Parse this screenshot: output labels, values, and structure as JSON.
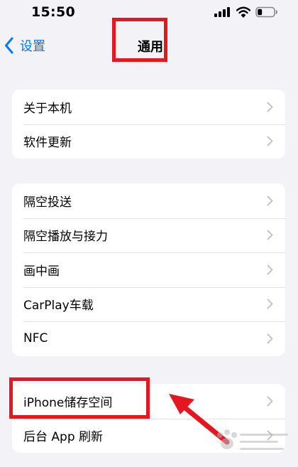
{
  "status_bar": {
    "time": "15:50"
  },
  "nav": {
    "back_label": "设置",
    "title": "通用"
  },
  "groups": [
    {
      "items": [
        {
          "label": "关于本机"
        },
        {
          "label": "软件更新"
        }
      ]
    },
    {
      "items": [
        {
          "label": "隔空投送"
        },
        {
          "label": "隔空播放与接力"
        },
        {
          "label": "画中画"
        },
        {
          "label": "CarPlay车载"
        },
        {
          "label": "NFC"
        }
      ]
    },
    {
      "items": [
        {
          "label": "iPhone储存空间"
        },
        {
          "label": "后台 App 刷新"
        }
      ]
    }
  ],
  "colors": {
    "background": "#f2f2f7",
    "accent": "#007aff",
    "annotation": "#e5161d",
    "chevron": "#c4c4c7"
  },
  "icons": {
    "signal": "cellular-signal-icon",
    "wifi": "wifi-icon",
    "battery": "battery-icon",
    "back": "chevron-left-icon",
    "row": "chevron-right-icon"
  }
}
